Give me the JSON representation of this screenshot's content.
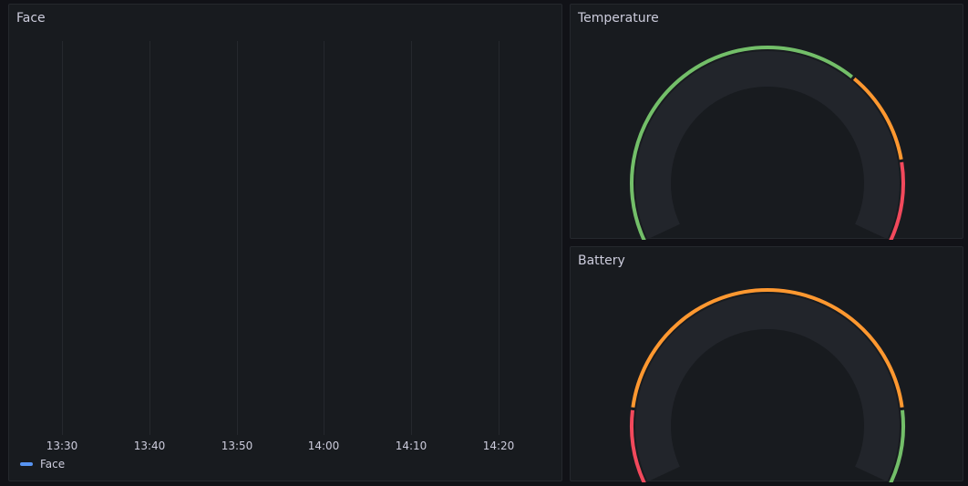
{
  "face_panel": {
    "title": "Face",
    "x_ticks": [
      "13:30",
      "13:40",
      "13:50",
      "14:00",
      "14:10",
      "14:20"
    ],
    "legend": {
      "label": "Face",
      "color": "#5794f2"
    }
  },
  "temperature_panel": {
    "title": "Temperature",
    "thresholds": [
      {
        "from": 0.0,
        "to": 0.67,
        "color": "#73bf69"
      },
      {
        "from": 0.67,
        "to": 0.85,
        "color": "#ff9830"
      },
      {
        "from": 0.85,
        "to": 1.0,
        "color": "#f2495c"
      }
    ],
    "value_fraction": 0
  },
  "battery_panel": {
    "title": "Battery",
    "thresholds": [
      {
        "from": 0.0,
        "to": 0.14,
        "color": "#f2495c"
      },
      {
        "from": 0.14,
        "to": 0.86,
        "color": "#ff9830"
      },
      {
        "from": 0.86,
        "to": 1.0,
        "color": "#73bf69"
      }
    ],
    "value_fraction": 0
  },
  "colors": {
    "background": "#111217",
    "panel": "#181b1f",
    "gauge_track": "#22252b"
  }
}
